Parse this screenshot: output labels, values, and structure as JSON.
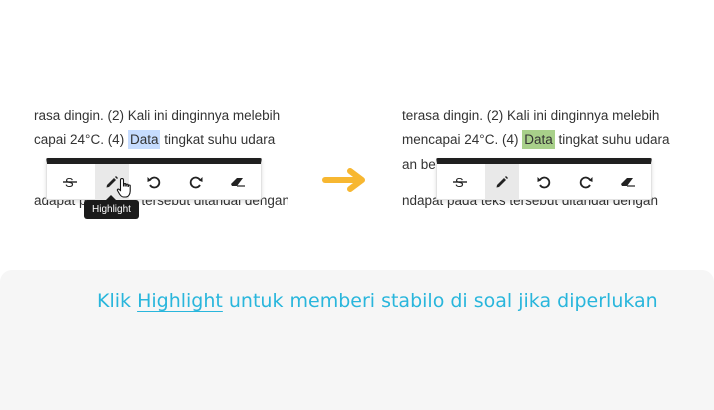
{
  "left": {
    "lines": [
      "rasa dingin. (2) Kali ini dinginnya melebih",
      "capai 24°C. (4) ",
      "adapat pada teks tersebut ditandai dengan"
    ],
    "highlight_word": "Data",
    "line2_tail": " tingkat suhu udara"
  },
  "right": {
    "lines": [
      "terasa dingin. (2) Kali ini dinginnya melebih",
      "mencapai 24°C. (4) ",
      "an be",
      "ndapat pada teks tersebut ditandai dengan"
    ],
    "highlight_word": "Data",
    "line2_tail": " tingkat suhu udara"
  },
  "toolbar": {
    "icons": [
      "strikethrough-icon",
      "pencil-icon",
      "undo-icon",
      "redo-icon",
      "eraser-icon"
    ]
  },
  "tooltip": "Highlight",
  "caption": {
    "prefix": "Klik ",
    "link": "Highlight",
    "suffix": " untuk memberi stabilo di soal jika diperlukan"
  },
  "colors": {
    "accent_arrow": "#f7b731",
    "caption": "#29b6dc",
    "highlight_blue": "#c6dcff",
    "highlight_green": "#a8d08a"
  }
}
